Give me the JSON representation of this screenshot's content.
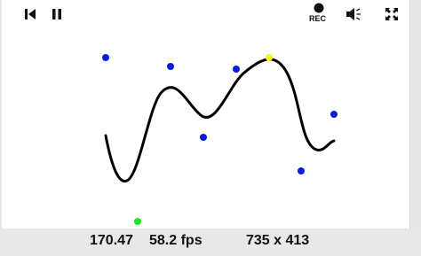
{
  "player": {
    "time": "170.47",
    "fps": "58.2 fps",
    "resolution": "735 x 413",
    "rec_label": "REC",
    "icons": {
      "rewind": "skip-to-start-icon",
      "pause": "pause-icon",
      "record": "record-icon",
      "volume": "volume-icon",
      "fullscreen": "fullscreen-icon"
    }
  },
  "scene": {
    "curve_color": "#000000",
    "dot_colors": {
      "blue": "#0a1adf",
      "yellow": "#f5f51a",
      "green": "#1ee61e"
    }
  }
}
